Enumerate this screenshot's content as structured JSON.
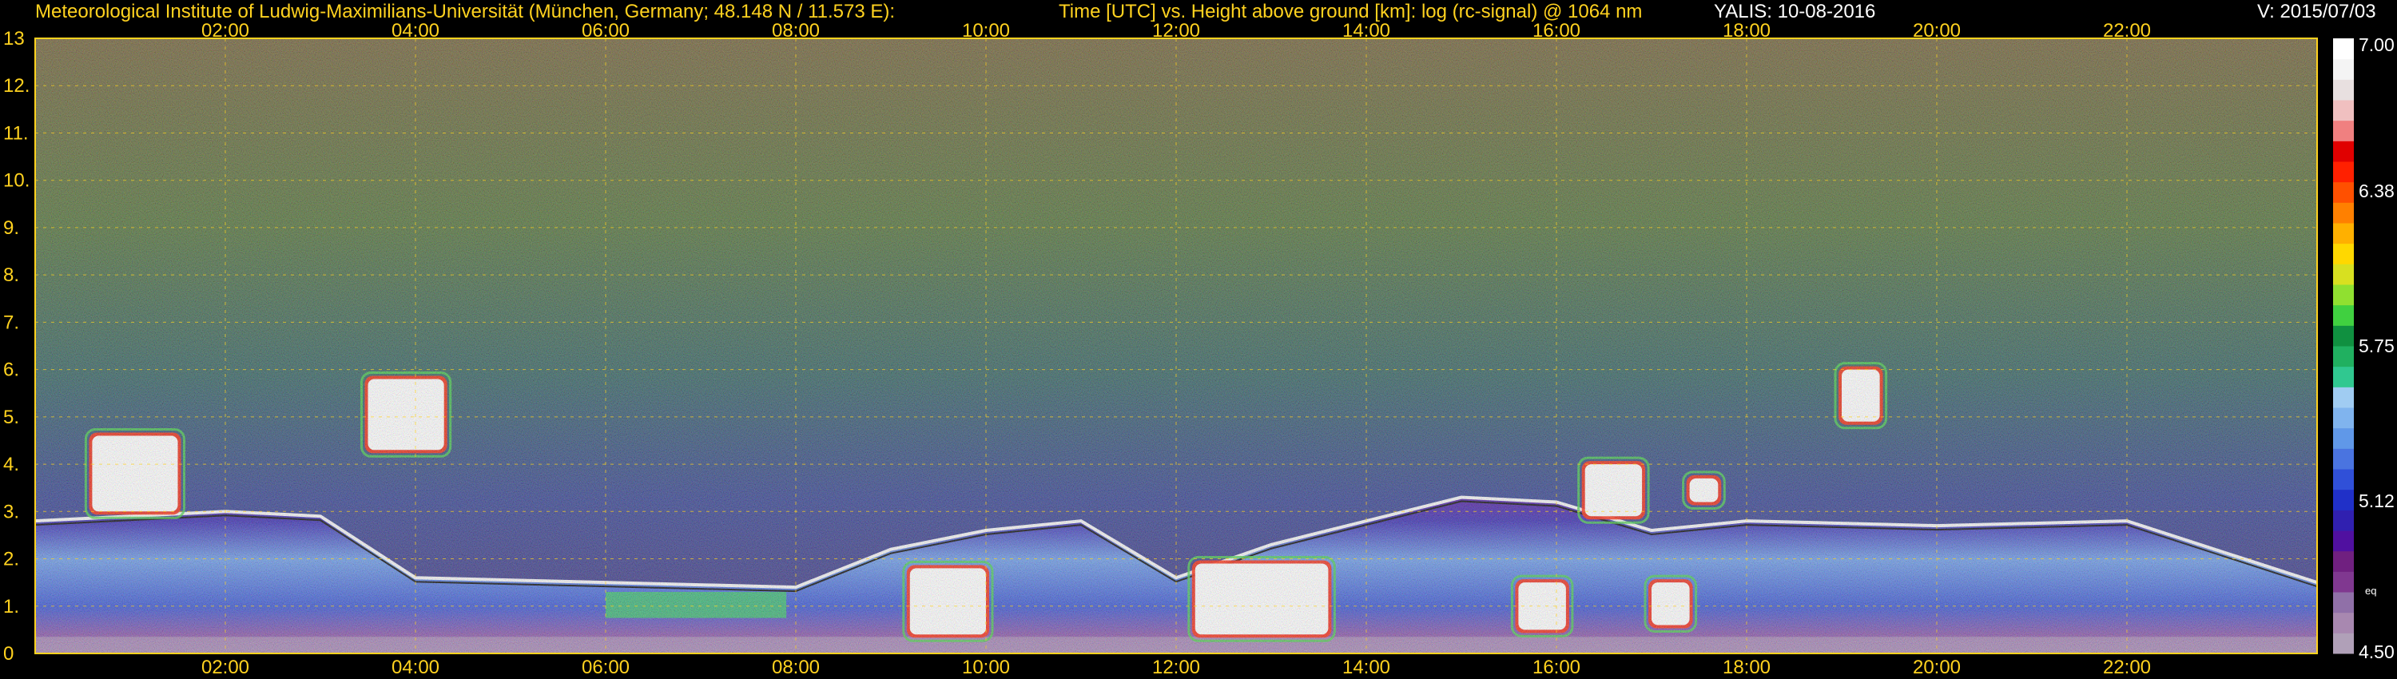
{
  "header": {
    "institute": "Meteorological Institute of Ludwig-Maximilians-Universität (München, Germany; 48.148 N / 11.573 E):",
    "title": "Time [UTC] vs. Height above ground [km]: log (rc-signal) @ 1064 nm",
    "station": "YALIS: 10-08-2016",
    "version": "V: 2015/07/03"
  },
  "chart_data": {
    "type": "heatmap",
    "title": "Time [UTC] vs. Height above ground [km]: log (rc-signal) @ 1064 nm",
    "xlabel": "Time [UTC]",
    "ylabel": "Height above ground [km]",
    "x_range_hours": [
      0,
      24
    ],
    "x_ticks": [
      "02:00",
      "04:00",
      "06:00",
      "08:00",
      "10:00",
      "12:00",
      "14:00",
      "16:00",
      "18:00",
      "20:00",
      "22:00"
    ],
    "ylim": [
      0,
      13
    ],
    "y_ticks": [
      "0",
      "1.",
      "2.",
      "3.",
      "4.",
      "5.",
      "6.",
      "7.",
      "8.",
      "9.",
      "10.",
      "11.",
      "12.",
      "13"
    ],
    "grid": true,
    "colorbar": {
      "range": [
        4.5,
        7.0
      ],
      "tick_labels": [
        "7.00",
        "6.38",
        "5.75",
        "5.12",
        "4.50"
      ],
      "tick_values": [
        7.0,
        6.38,
        5.75,
        5.12,
        4.5
      ],
      "extra_label": "eq",
      "colors": [
        "#b0a0b8",
        "#a888b0",
        "#9070a8",
        "#803890",
        "#702080",
        "#5010a0",
        "#3020b0",
        "#2030c8",
        "#3050d8",
        "#4a74e0",
        "#6098e8",
        "#80b4ee",
        "#a0ccf2",
        "#30c890",
        "#20b060",
        "#109040",
        "#40d040",
        "#90e030",
        "#d8e020",
        "#ffd800",
        "#ffb000",
        "#ff8000",
        "#ff5000",
        "#ff2000",
        "#e00000",
        "#f08080",
        "#f0c0c0",
        "#e8e0e0",
        "#f4f4f4",
        "#ffffff"
      ]
    },
    "cloud_features": [
      {
        "t": [
          0.6,
          1.5
        ],
        "h": [
          3.0,
          4.6
        ],
        "kind": "cloud"
      },
      {
        "t": [
          3.5,
          4.3
        ],
        "h": [
          4.3,
          5.8
        ],
        "kind": "cloud"
      },
      {
        "t": [
          9.2,
          10.0
        ],
        "h": [
          0.4,
          1.8
        ],
        "kind": "convective"
      },
      {
        "t": [
          12.2,
          13.6
        ],
        "h": [
          0.4,
          1.9
        ],
        "kind": "convective"
      },
      {
        "t": [
          15.6,
          16.1
        ],
        "h": [
          0.5,
          1.5
        ],
        "kind": "convective"
      },
      {
        "t": [
          16.3,
          16.9
        ],
        "h": [
          2.9,
          4.0
        ],
        "kind": "cloud"
      },
      {
        "t": [
          17.0,
          17.4
        ],
        "h": [
          0.6,
          1.5
        ],
        "kind": "convective"
      },
      {
        "t": [
          19.0,
          19.4
        ],
        "h": [
          4.9,
          6.0
        ],
        "kind": "cloud"
      },
      {
        "t": [
          17.4,
          17.7
        ],
        "h": [
          3.2,
          3.7
        ],
        "kind": "cloud"
      }
    ],
    "boundary_layer_top_km": [
      [
        0.0,
        2.8
      ],
      [
        1.0,
        2.9
      ],
      [
        2.0,
        3.0
      ],
      [
        3.0,
        2.9
      ],
      [
        4.0,
        1.6
      ],
      [
        6.0,
        1.5
      ],
      [
        8.0,
        1.4
      ],
      [
        9.0,
        2.2
      ],
      [
        10.0,
        2.6
      ],
      [
        11.0,
        2.8
      ],
      [
        12.0,
        1.6
      ],
      [
        13.0,
        2.3
      ],
      [
        14.0,
        2.8
      ],
      [
        15.0,
        3.3
      ],
      [
        16.0,
        3.2
      ],
      [
        17.0,
        2.6
      ],
      [
        18.0,
        2.8
      ],
      [
        20.0,
        2.7
      ],
      [
        22.0,
        2.8
      ],
      [
        24.0,
        1.5
      ]
    ]
  }
}
